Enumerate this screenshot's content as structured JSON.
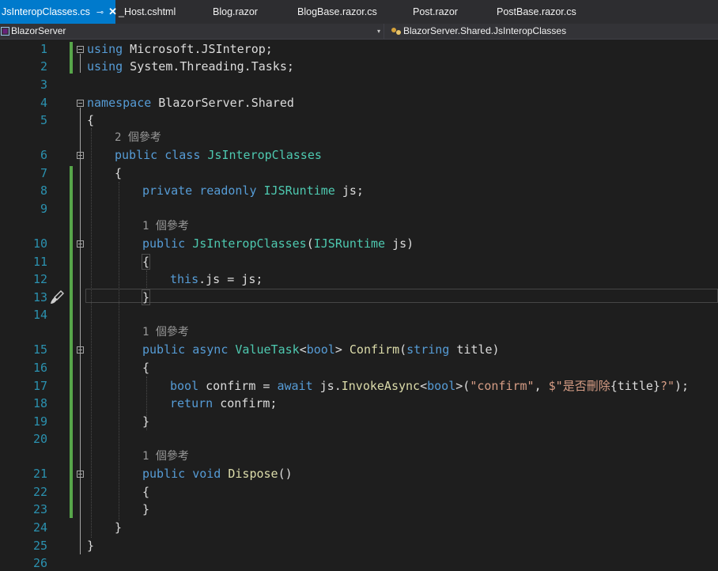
{
  "tabs": [
    {
      "label": "JsInteropClasses.cs",
      "active": true,
      "pin": "⊸",
      "close": "✕"
    },
    {
      "label": "_Host.cshtml"
    },
    {
      "label": "Blog.razor"
    },
    {
      "label": "BlogBase.razor.cs"
    },
    {
      "label": "Post.razor"
    },
    {
      "label": "PostBase.razor.cs"
    }
  ],
  "navbar": {
    "project": "BlazorServer",
    "type_scope": "BlazorServer.Shared.JsInteropClasses",
    "dropdown_glyph": "▾"
  },
  "line_numbers": [
    "1",
    "2",
    "3",
    "4",
    "5",
    "6",
    "7",
    "8",
    "9",
    "10",
    "11",
    "12",
    "13",
    "14",
    "15",
    "16",
    "17",
    "18",
    "19",
    "20",
    "21",
    "22",
    "23",
    "24",
    "25",
    "26"
  ],
  "code_lens": {
    "class_refs": "2 個參考",
    "field_refs": "1 個參考",
    "confirm_refs": "1 個參考",
    "dispose_refs": "1 個參考"
  },
  "code": {
    "l1_kw": "using",
    "l1_rest": " Microsoft.JSInterop;",
    "l2_kw": "using",
    "l2_rest": " System.Threading.Tasks;",
    "l4_kw": "namespace",
    "l4_rest": " BlazorServer.Shared",
    "l5": "{",
    "l6_kw": "public class",
    "l6_type": "JsInteropClasses",
    "l7": "{",
    "l8_kw": "private readonly",
    "l8_type": "IJSRuntime",
    "l8_rest": " js;",
    "l10_kw": "public",
    "l10_type": "JsInteropClasses",
    "l10_p1": "(",
    "l10_type2": "IJSRuntime",
    "l10_p2": " js)",
    "l11": "{",
    "l12_kw": "this",
    "l12_rest": ".js = js;",
    "l13": "}",
    "l15_kw": "public async",
    "l15_type": "ValueTask",
    "l15_lt": "<",
    "l15_kw2": "bool",
    "l15_gt": "> ",
    "l15_fn": "Confirm",
    "l15_p1": "(",
    "l15_kw3": "string",
    "l15_p2": " title)",
    "l16": "{",
    "l17_kw": "bool",
    "l17_a": " confirm = ",
    "l17_kw2": "await",
    "l17_b": " js.",
    "l17_fn": "InvokeAsync",
    "l17_lt": "<",
    "l17_kw3": "bool",
    "l17_c": ">(",
    "l17_s1": "\"confirm\"",
    "l17_d": ", ",
    "l17_s2": "$\"是否刪除",
    "l17_e": "{title}",
    "l17_s3": "?\"",
    "l17_f": ");",
    "l18_kw": "return",
    "l18_rest": " confirm;",
    "l19": "}",
    "l21_kw": "public void",
    "l21_fn": "Dispose",
    "l21_rest": "()",
    "l22": "{",
    "l23": "}",
    "l24": "}",
    "l25": "}"
  },
  "colors": {
    "accent_tab": "#007acc",
    "keyword": "#569cd6",
    "type": "#4ec9b0",
    "method": "#dcdcaa",
    "string": "#d69d85",
    "line_number": "#2b91af",
    "change_bar": "#57a64a"
  },
  "icons": {
    "project": "csharp-project-icon",
    "scope": "class-icon",
    "quick_action": "paintbrush-icon"
  }
}
